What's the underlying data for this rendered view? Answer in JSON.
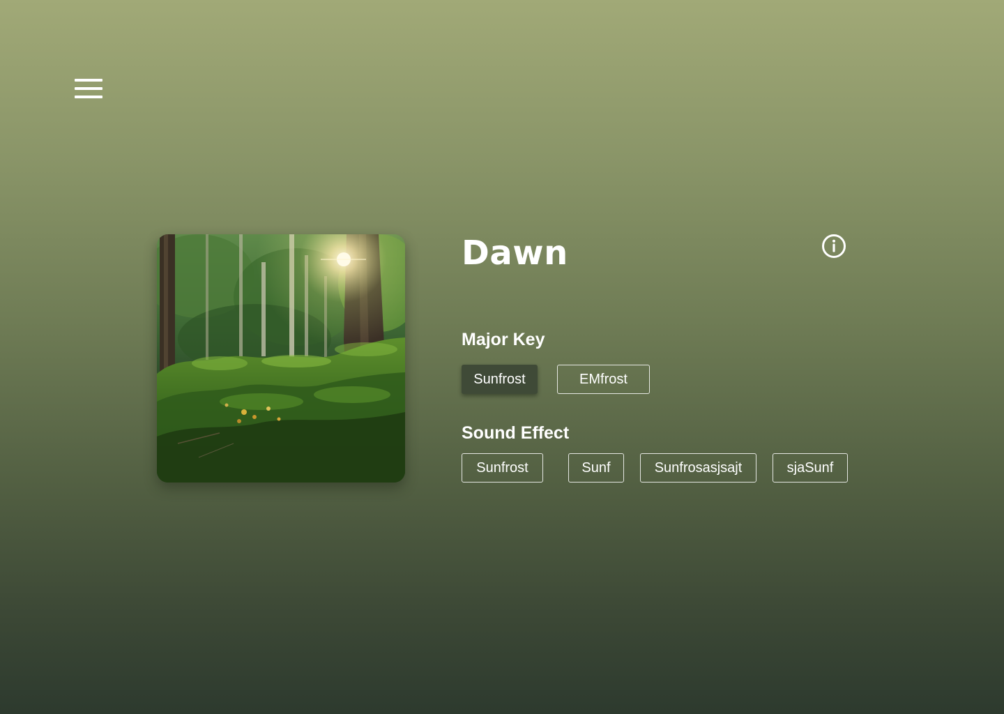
{
  "header": {
    "menu_icon": "hamburger-menu-icon"
  },
  "track": {
    "title": "Dawn",
    "artwork_icon": "forest-artwork-image",
    "info_icon": "info-circle-icon"
  },
  "major_key": {
    "heading": "Major Key",
    "options": [
      {
        "label": "Sunfrost",
        "selected": true
      },
      {
        "label": "EMfrost",
        "selected": false
      }
    ]
  },
  "sound_effect": {
    "heading": "Sound Effect",
    "options": [
      {
        "label": "Sunfrost",
        "selected": false
      },
      {
        "label": "Sunf",
        "selected": false
      },
      {
        "label": "Sunfrosasjsajt",
        "selected": false
      },
      {
        "label": "sjaSunf",
        "selected": false
      }
    ]
  },
  "colors": {
    "background_top": "#a1a977",
    "background_bottom": "#2d3a2e",
    "chip_selected": "#3f4a37",
    "text": "#ffffff"
  }
}
